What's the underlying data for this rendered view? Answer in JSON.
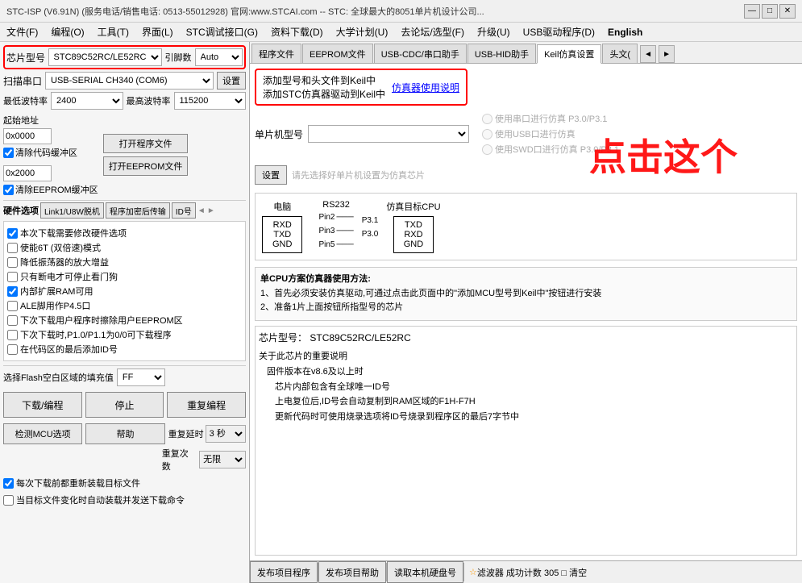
{
  "titlebar": {
    "text": "STC-ISP (V6.91N) (服务电话/销售电话: 0513-55012928) 官网:www.STCAI.com  -- STC: 全球最大的8051单片机设计公司...",
    "min_btn": "—",
    "max_btn": "□",
    "close_btn": "✕"
  },
  "menubar": {
    "items": [
      {
        "label": "文件(F)"
      },
      {
        "label": "编程(O)"
      },
      {
        "label": "工具(T)"
      },
      {
        "label": "界面(L)"
      },
      {
        "label": "STC调试接口(G)"
      },
      {
        "label": "资料下载(D)"
      },
      {
        "label": "大学计划(U)"
      },
      {
        "label": "去论坛/选型(F)"
      },
      {
        "label": "升级(U)"
      },
      {
        "label": "USB驱动程序(D)"
      },
      {
        "label": "English"
      }
    ]
  },
  "left": {
    "chip_label": "芯片型号",
    "chip_value": "STC89C52RC/LE52RC",
    "引脚数_label": "引脚数",
    "引脚数_value": "Auto",
    "scan_label": "扫描串口",
    "scan_value": "USB-SERIAL CH340 (COM6)",
    "设置_btn": "设置",
    "最低波特率_label": "最低波特率",
    "最低波特率_value": "2400",
    "最高波特率_label": "最高波特率",
    "最高波特率_value": "115200",
    "addr1_label": "起始地址",
    "addr1_value": "0x0000",
    "clear_code_label": "清除代码缓冲区",
    "open_prog_btn": "打开程序文件",
    "addr2_value": "0x2000",
    "clear_eeprom_label": "清除EEPROM缓冲区",
    "open_eeprom_btn": "打开EEPROM文件",
    "hardware_label": "硬件选项",
    "hw_btns": [
      "Link1/U8W脱机",
      "程序加密后传输",
      "ID号"
    ],
    "options": [
      {
        "label": "本次下载需要修改硬件选项",
        "checked": true
      },
      {
        "label": "使能6T (双倍速)模式",
        "checked": false
      },
      {
        "label": "降低振荡器的放大增益",
        "checked": false
      },
      {
        "label": "只有断电才可停止看门狗",
        "checked": false
      },
      {
        "label": "内部扩展RAM可用",
        "checked": true
      },
      {
        "label": "ALE脚用作P4.5口",
        "checked": false
      },
      {
        "label": "下次下载用户程序时擦除用户EEPROM区",
        "checked": false
      },
      {
        "label": "下次下载时,P1.0/P1.1为0/0可下载程序",
        "checked": false
      },
      {
        "label": "在代码区的最后添加ID号",
        "checked": false
      }
    ],
    "flash_label": "选择Flash空白区域的填充值",
    "flash_value": "FF",
    "download_btn": "下载/编程",
    "stop_btn": "停止",
    "reprogram_btn": "重复编程",
    "detect_btn": "检测MCU选项",
    "help_btn": "帮助",
    "delay_label": "重复延时",
    "delay_value": "3 秒",
    "repeat_label": "重复次数",
    "repeat_value": "无限",
    "reload_label": "每次下载前都重新装载目标文件",
    "reload_checked": true,
    "auto_label": "当目标文件变化时自动装载并发送下载命令",
    "auto_checked": false
  },
  "right": {
    "tabs": [
      {
        "label": "程序文件",
        "active": false
      },
      {
        "label": "EEPROM文件",
        "active": false
      },
      {
        "label": "USB-CDC/串口助手",
        "active": false
      },
      {
        "label": "USB-HID助手",
        "active": false
      },
      {
        "label": "Keil仿真设置",
        "active": true
      },
      {
        "label": "头文(",
        "active": false
      }
    ],
    "keil": {
      "line1": "添加型号和头文件到Keil中",
      "line2": "添加STC仿真器驱动到Keil中",
      "link_text": "仿真器使用说明"
    },
    "mcu_type_label": "单片机型号",
    "sim_options": [
      {
        "label": "使用串口进行仿真 P3.0/P3.1",
        "enabled": false
      },
      {
        "label": "使用USB口进行仿真",
        "enabled": false
      },
      {
        "label": "使用SWD口进行仿真 P3.0/P3.1",
        "enabled": false
      }
    ],
    "set_chip_text": "请先选择好单片机设置为仿真芯片",
    "set_chip_btn": "设置",
    "diagram": {
      "pc_label": "电脑",
      "rs232_label": "RS232",
      "cpu_label": "仿真目标CPU",
      "pin2": "Pin2",
      "pin3": "Pin3",
      "pin5": "Pin5",
      "p31": "P3.1",
      "p30": "P3.0",
      "rxd_left": "RXD",
      "txd_left": "TXD",
      "gnd_left": "GND",
      "txd_right": "TXD",
      "rxd_right": "RXD",
      "gnd_right": "GND"
    },
    "instructions": {
      "title": "单CPU方案仿真器使用方法:",
      "line1": "1、首先必须安装仿真驱动,可通过点击此页面中的\"添加MCU型号到Keil中\"按钮进行安装",
      "line2": "2、准备1片上面按钮所指型号的芯片"
    },
    "info": {
      "chip_type_label": "芯片型号：",
      "chip_type_value": "STC89C52RC/LE52RC",
      "desc_title": "关于此芯片的重要说明",
      "lines": [
        "固件版本在v8.6及以上时",
        "  芯片内部包含有全球唯一ID号",
        "  上电复位后,ID号会自动复制到RAM区域的F1H-F7H",
        "  更新代码时可使用烧录选项将ID号烧录到程序区的最后7字节中"
      ]
    },
    "big_text": "点击这个",
    "bottom_btns": [
      {
        "label": "发布项目程序"
      },
      {
        "label": "发布项目帮助"
      },
      {
        "label": "读取本机硬盘号"
      },
      {
        "label": "☆ 滤波器 成功计数 305 □ 清空"
      }
    ]
  }
}
